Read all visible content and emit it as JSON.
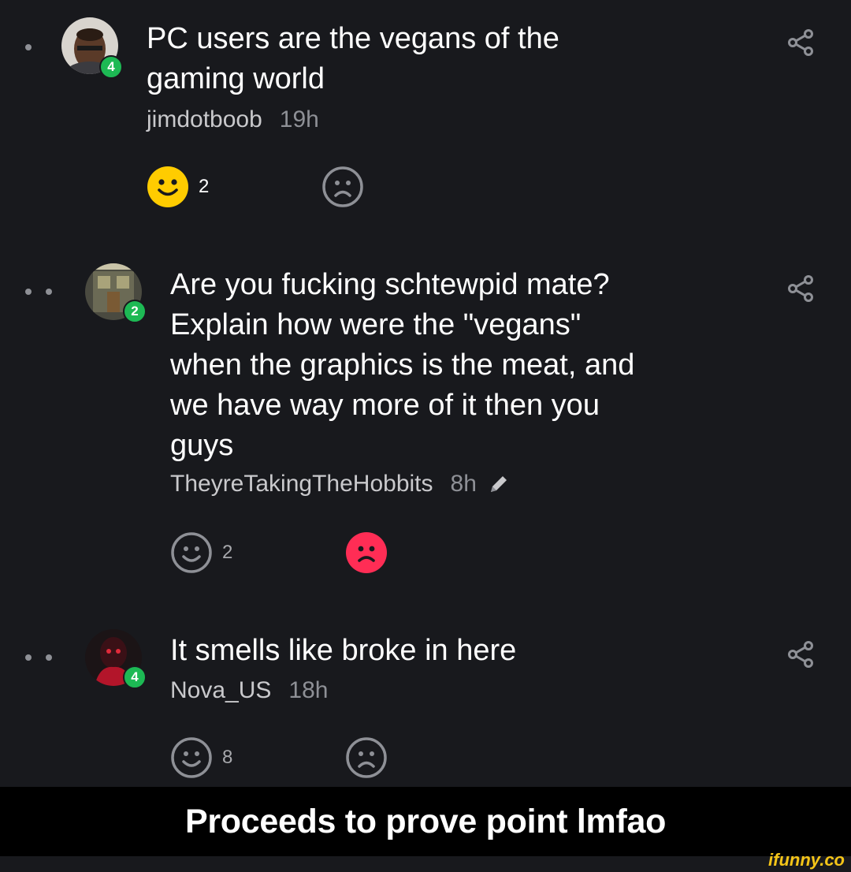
{
  "comments": [
    {
      "text_lines": [
        "PC users are the vegans of the",
        "gaming world"
      ],
      "username": "jimdotboob",
      "time": "19h",
      "level": "4",
      "edited": false,
      "smile_count": "2",
      "smile_active": true,
      "frown_active": false
    },
    {
      "text_lines": [
        "Are you fucking schtewpid mate?",
        "Explain how were the \"vegans\"",
        "when the graphics is the meat, and",
        "we have way more of it then you",
        "guys"
      ],
      "username": "TheyreTakingTheHobbits",
      "time": "8h",
      "level": "2",
      "edited": true,
      "smile_count": "2",
      "smile_active": false,
      "frown_active": true
    },
    {
      "text_lines": [
        "It smells like broke in here"
      ],
      "username": "Nova_US",
      "time": "18h",
      "level": "4",
      "edited": false,
      "smile_count": "8",
      "smile_active": false,
      "frown_active": false
    }
  ],
  "caption": "Proceeds to prove point lmfao",
  "watermark": "ifunny.co",
  "colors": {
    "background": "#18191d",
    "smile_active": "#ffcc00",
    "frown_active": "#ff2d55",
    "level_badge": "#1db954",
    "icon_muted": "#8e9096"
  }
}
